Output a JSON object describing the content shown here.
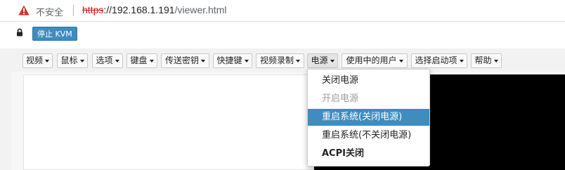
{
  "browser": {
    "security_label": "不安全",
    "url": {
      "scheme": "https",
      "host": "://192.168.1.191",
      "path": "/viewer.html"
    },
    "warning_color": "#d93025"
  },
  "toolbar": {
    "lock_icon": "lock-icon",
    "stop_kvm_label": "停止 KVM",
    "accent_color": "#3f8cbe"
  },
  "menubar": {
    "items": [
      {
        "label": "视频"
      },
      {
        "label": "鼠标"
      },
      {
        "label": "选项"
      },
      {
        "label": "键盘"
      },
      {
        "label": "传送密钥"
      },
      {
        "label": "快捷键"
      },
      {
        "label": "视频录制"
      },
      {
        "label": "电源"
      },
      {
        "label": "使用中的用户"
      },
      {
        "label": "选择启动项"
      },
      {
        "label": "帮助"
      }
    ],
    "open_menu": "电源"
  },
  "power_menu": {
    "items": [
      {
        "label": "关闭电源",
        "state": "enabled"
      },
      {
        "label": "开启电源",
        "state": "disabled"
      },
      {
        "label": "重启系统(关闭电源)",
        "state": "highlighted"
      },
      {
        "label": "重启系统(不关闭电源)",
        "state": "enabled"
      },
      {
        "label": "ACPI关闭",
        "state": "enabled"
      }
    ]
  }
}
